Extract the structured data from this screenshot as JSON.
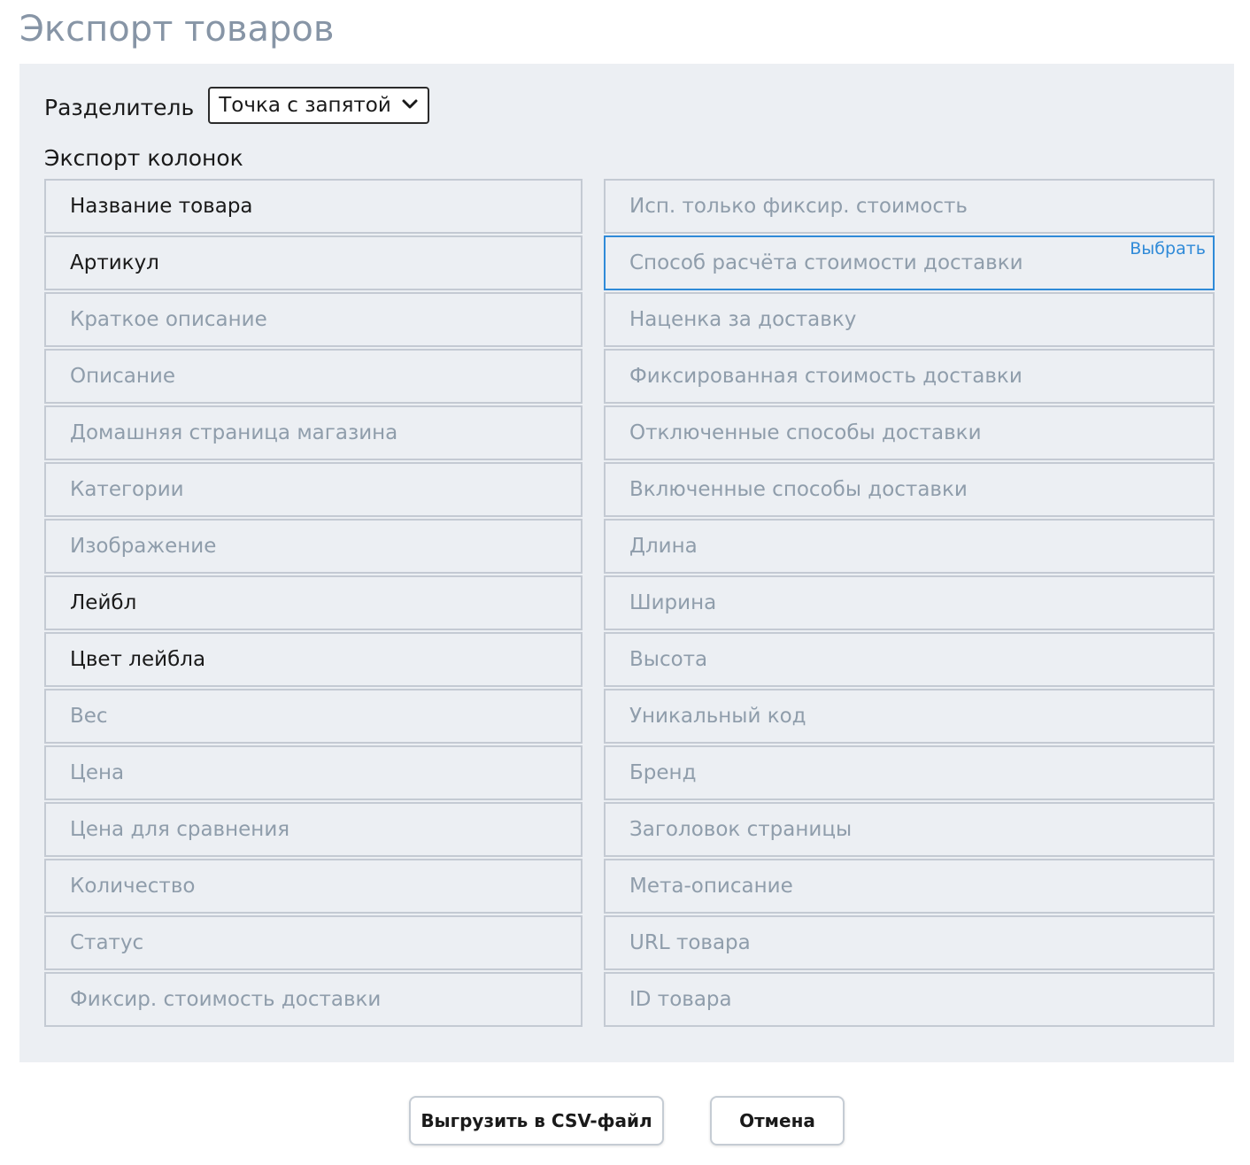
{
  "page": {
    "title": "Экспорт товаров"
  },
  "separator": {
    "label": "Разделитель",
    "value": "Точка с запятой"
  },
  "columns": {
    "label": "Экспорт колонок",
    "left": [
      {
        "label": "Название товара",
        "active": true
      },
      {
        "label": "Артикул",
        "active": true
      },
      {
        "label": "Краткое описание",
        "active": false
      },
      {
        "label": "Описание",
        "active": false
      },
      {
        "label": "Домашняя страница магазина",
        "active": false
      },
      {
        "label": "Категории",
        "active": false
      },
      {
        "label": "Изображение",
        "active": false
      },
      {
        "label": "Лейбл",
        "active": true
      },
      {
        "label": "Цвет лейбла",
        "active": true
      },
      {
        "label": "Вес",
        "active": false
      },
      {
        "label": "Цена",
        "active": false
      },
      {
        "label": "Цена для сравнения",
        "active": false
      },
      {
        "label": "Количество",
        "active": false
      },
      {
        "label": "Статус",
        "active": false
      },
      {
        "label": "Фиксир. стоимость доставки",
        "active": false
      }
    ],
    "right": [
      {
        "label": "Исп. только фиксир. стоимость",
        "active": false
      },
      {
        "label": "Способ расчёта стоимости доставки",
        "active": false,
        "action": "Выбрать"
      },
      {
        "label": "Наценка за доставку",
        "active": false
      },
      {
        "label": "Фиксированная стоимость доставки",
        "active": false
      },
      {
        "label": "Отключенные способы доставки",
        "active": false
      },
      {
        "label": "Включенные способы доставки",
        "active": false
      },
      {
        "label": "Длина",
        "active": false
      },
      {
        "label": "Ширина",
        "active": false
      },
      {
        "label": "Высота",
        "active": false
      },
      {
        "label": "Уникальный код",
        "active": false
      },
      {
        "label": "Бренд",
        "active": false
      },
      {
        "label": "Заголовок страницы",
        "active": false
      },
      {
        "label": "Мета-описание",
        "active": false
      },
      {
        "label": "URL товара",
        "active": false
      },
      {
        "label": "ID товара",
        "active": false
      }
    ]
  },
  "actions": {
    "export_label": "Выгрузить в CSV-файл",
    "cancel_label": "Отмена"
  },
  "colors": {
    "accent": "#2f8ad8",
    "panel_bg": "#eceff3",
    "inactive_text": "#8f9dab",
    "title": "#8795a6"
  }
}
